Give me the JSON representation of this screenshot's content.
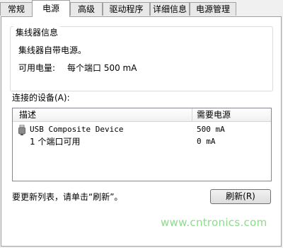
{
  "tabs": [
    "常规",
    "电源",
    "高级",
    "驱动程序",
    "详细信息",
    "电源管理"
  ],
  "active_tab": "电源",
  "hub_info": {
    "title": "集线器信息",
    "self_powered": "集线器自带电源。",
    "available_power_label": "可用电量:",
    "available_power_value": "每个端口 500 mA"
  },
  "devices": {
    "label": "连接的设备(A):",
    "columns": [
      "描述",
      "需要电源"
    ],
    "rows": [
      {
        "icon": "usb-plug-icon",
        "description": "USB Composite Device",
        "power": "500 mA"
      },
      {
        "icon": "",
        "description": "1 个端口可用",
        "power": "0 mA"
      }
    ]
  },
  "hint": "要更新列表，请单击“刷新”。",
  "refresh_button": "刷新(R)",
  "watermark": "www.cntronics.com"
}
